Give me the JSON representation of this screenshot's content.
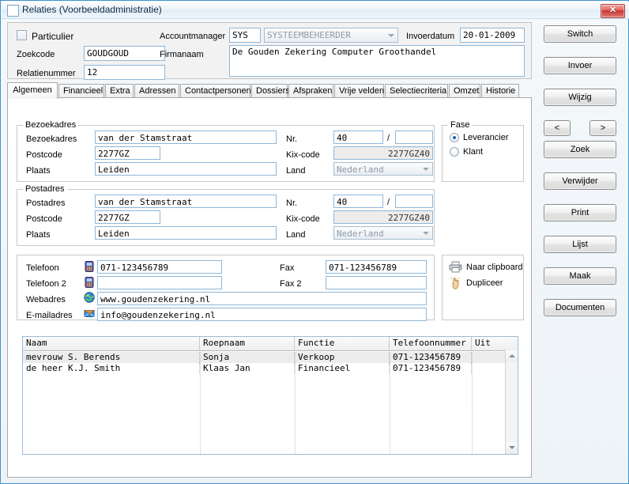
{
  "window": {
    "title": "Relaties (Voorbeeldadministratie)",
    "close_label": "✕",
    "accent": "#3f93cd",
    "close_color": "#c8352e"
  },
  "header": {
    "particulier_label": "Particulier",
    "particulier_checked": false,
    "zoekcode_label": "Zoekcode",
    "zoekcode_value": "GOUDGOUD",
    "relatienummer_label": "Relatienummer",
    "relatienummer_value": "12",
    "accountmanager_label": "Accountmanager",
    "accountmanager_code": "SYS",
    "accountmanager_name": "SYSTEEMBEHEERDER",
    "invoerdatum_label": "Invoerdatum",
    "invoerdatum_value": "20-01-2009",
    "firmanaam_label": "Firmanaam",
    "firmanaam_value": "De Gouden Zekering Computer Groothandel"
  },
  "tabs": [
    {
      "label": "Algemeen",
      "active": true
    },
    {
      "label": "Financieel",
      "active": false
    },
    {
      "label": "Extra",
      "active": false
    },
    {
      "label": "Adressen",
      "active": false
    },
    {
      "label": "Contactpersonen",
      "active": false
    },
    {
      "label": "Dossiers",
      "active": false
    },
    {
      "label": "Afspraken",
      "active": false
    },
    {
      "label": "Vrije velden",
      "active": false
    },
    {
      "label": "Selectiecriteria",
      "active": false
    },
    {
      "label": "Omzet",
      "active": false
    },
    {
      "label": "Historie",
      "active": false
    }
  ],
  "bezoekadres": {
    "group_title": "Bezoekadres",
    "adres_label": "Bezoekadres",
    "adres_value": "van der Stamstraat",
    "nr_label": "Nr.",
    "nr_value": "40",
    "nr_sep": "/",
    "nr_toevoeging_value": "",
    "postcode_label": "Postcode",
    "postcode_value": "2277GZ",
    "kix_label": "Kix-code",
    "kix_value": "2277GZ40",
    "plaats_label": "Plaats",
    "plaats_value": "Leiden",
    "land_label": "Land",
    "land_value": "Nederland"
  },
  "postadres": {
    "group_title": "Postadres",
    "adres_label": "Postadres",
    "adres_value": "van der Stamstraat",
    "nr_label": "Nr.",
    "nr_value": "40",
    "nr_sep": "/",
    "nr_toevoeging_value": "",
    "postcode_label": "Postcode",
    "postcode_value": "2277GZ",
    "kix_label": "Kix-code",
    "kix_value": "2277GZ40",
    "plaats_label": "Plaats",
    "plaats_value": "Leiden",
    "land_label": "Land",
    "land_value": "Nederland"
  },
  "fase": {
    "group_title": "Fase",
    "options": [
      {
        "label": "Leverancier",
        "selected": true
      },
      {
        "label": "Klant",
        "selected": false
      }
    ]
  },
  "contact": {
    "telefoon_label": "Telefoon",
    "telefoon_value": "071-123456789",
    "telefoon_icon": "mobile-phone-icon",
    "telefoon2_label": "Telefoon 2",
    "telefoon2_value": "",
    "telefoon2_icon": "mobile-phone-icon",
    "webadres_label": "Webadres",
    "webadres_value": "www.goudenzekering.nl",
    "webadres_icon": "globe-icon",
    "email_label": "E-mailadres",
    "email_value": "info@goudenzekering.nl",
    "email_icon": "envelope-icon",
    "fax_label": "Fax",
    "fax_value": "071-123456789",
    "fax2_label": "Fax 2",
    "fax2_value": ""
  },
  "actions": {
    "clipboard_label": "Naar clipboard",
    "clipboard_icon": "printer-icon",
    "dupliceer_label": "Dupliceer",
    "dupliceer_icon": "hand-click-icon"
  },
  "grid": {
    "columns": [
      "Naam",
      "Roepnaam",
      "Functie",
      "Telefoonnummer",
      "Uit"
    ],
    "rows": [
      {
        "selected": true,
        "cells": [
          "mevrouw S. Berends",
          "Sonja",
          "Verkoop",
          "071-123456789",
          ""
        ]
      },
      {
        "selected": false,
        "cells": [
          "de heer K.J. Smith",
          "Klaas Jan",
          "Financieel",
          "071-123456789",
          ""
        ]
      }
    ]
  },
  "buttons": {
    "switch": "Switch",
    "invoer": "Invoer",
    "wijzig": "Wijzig",
    "prev": "<",
    "next": ">",
    "zoek": "Zoek",
    "verwijder": "Verwijder",
    "print": "Print",
    "lijst": "Lijst",
    "maak": "Maak",
    "documenten": "Documenten"
  }
}
